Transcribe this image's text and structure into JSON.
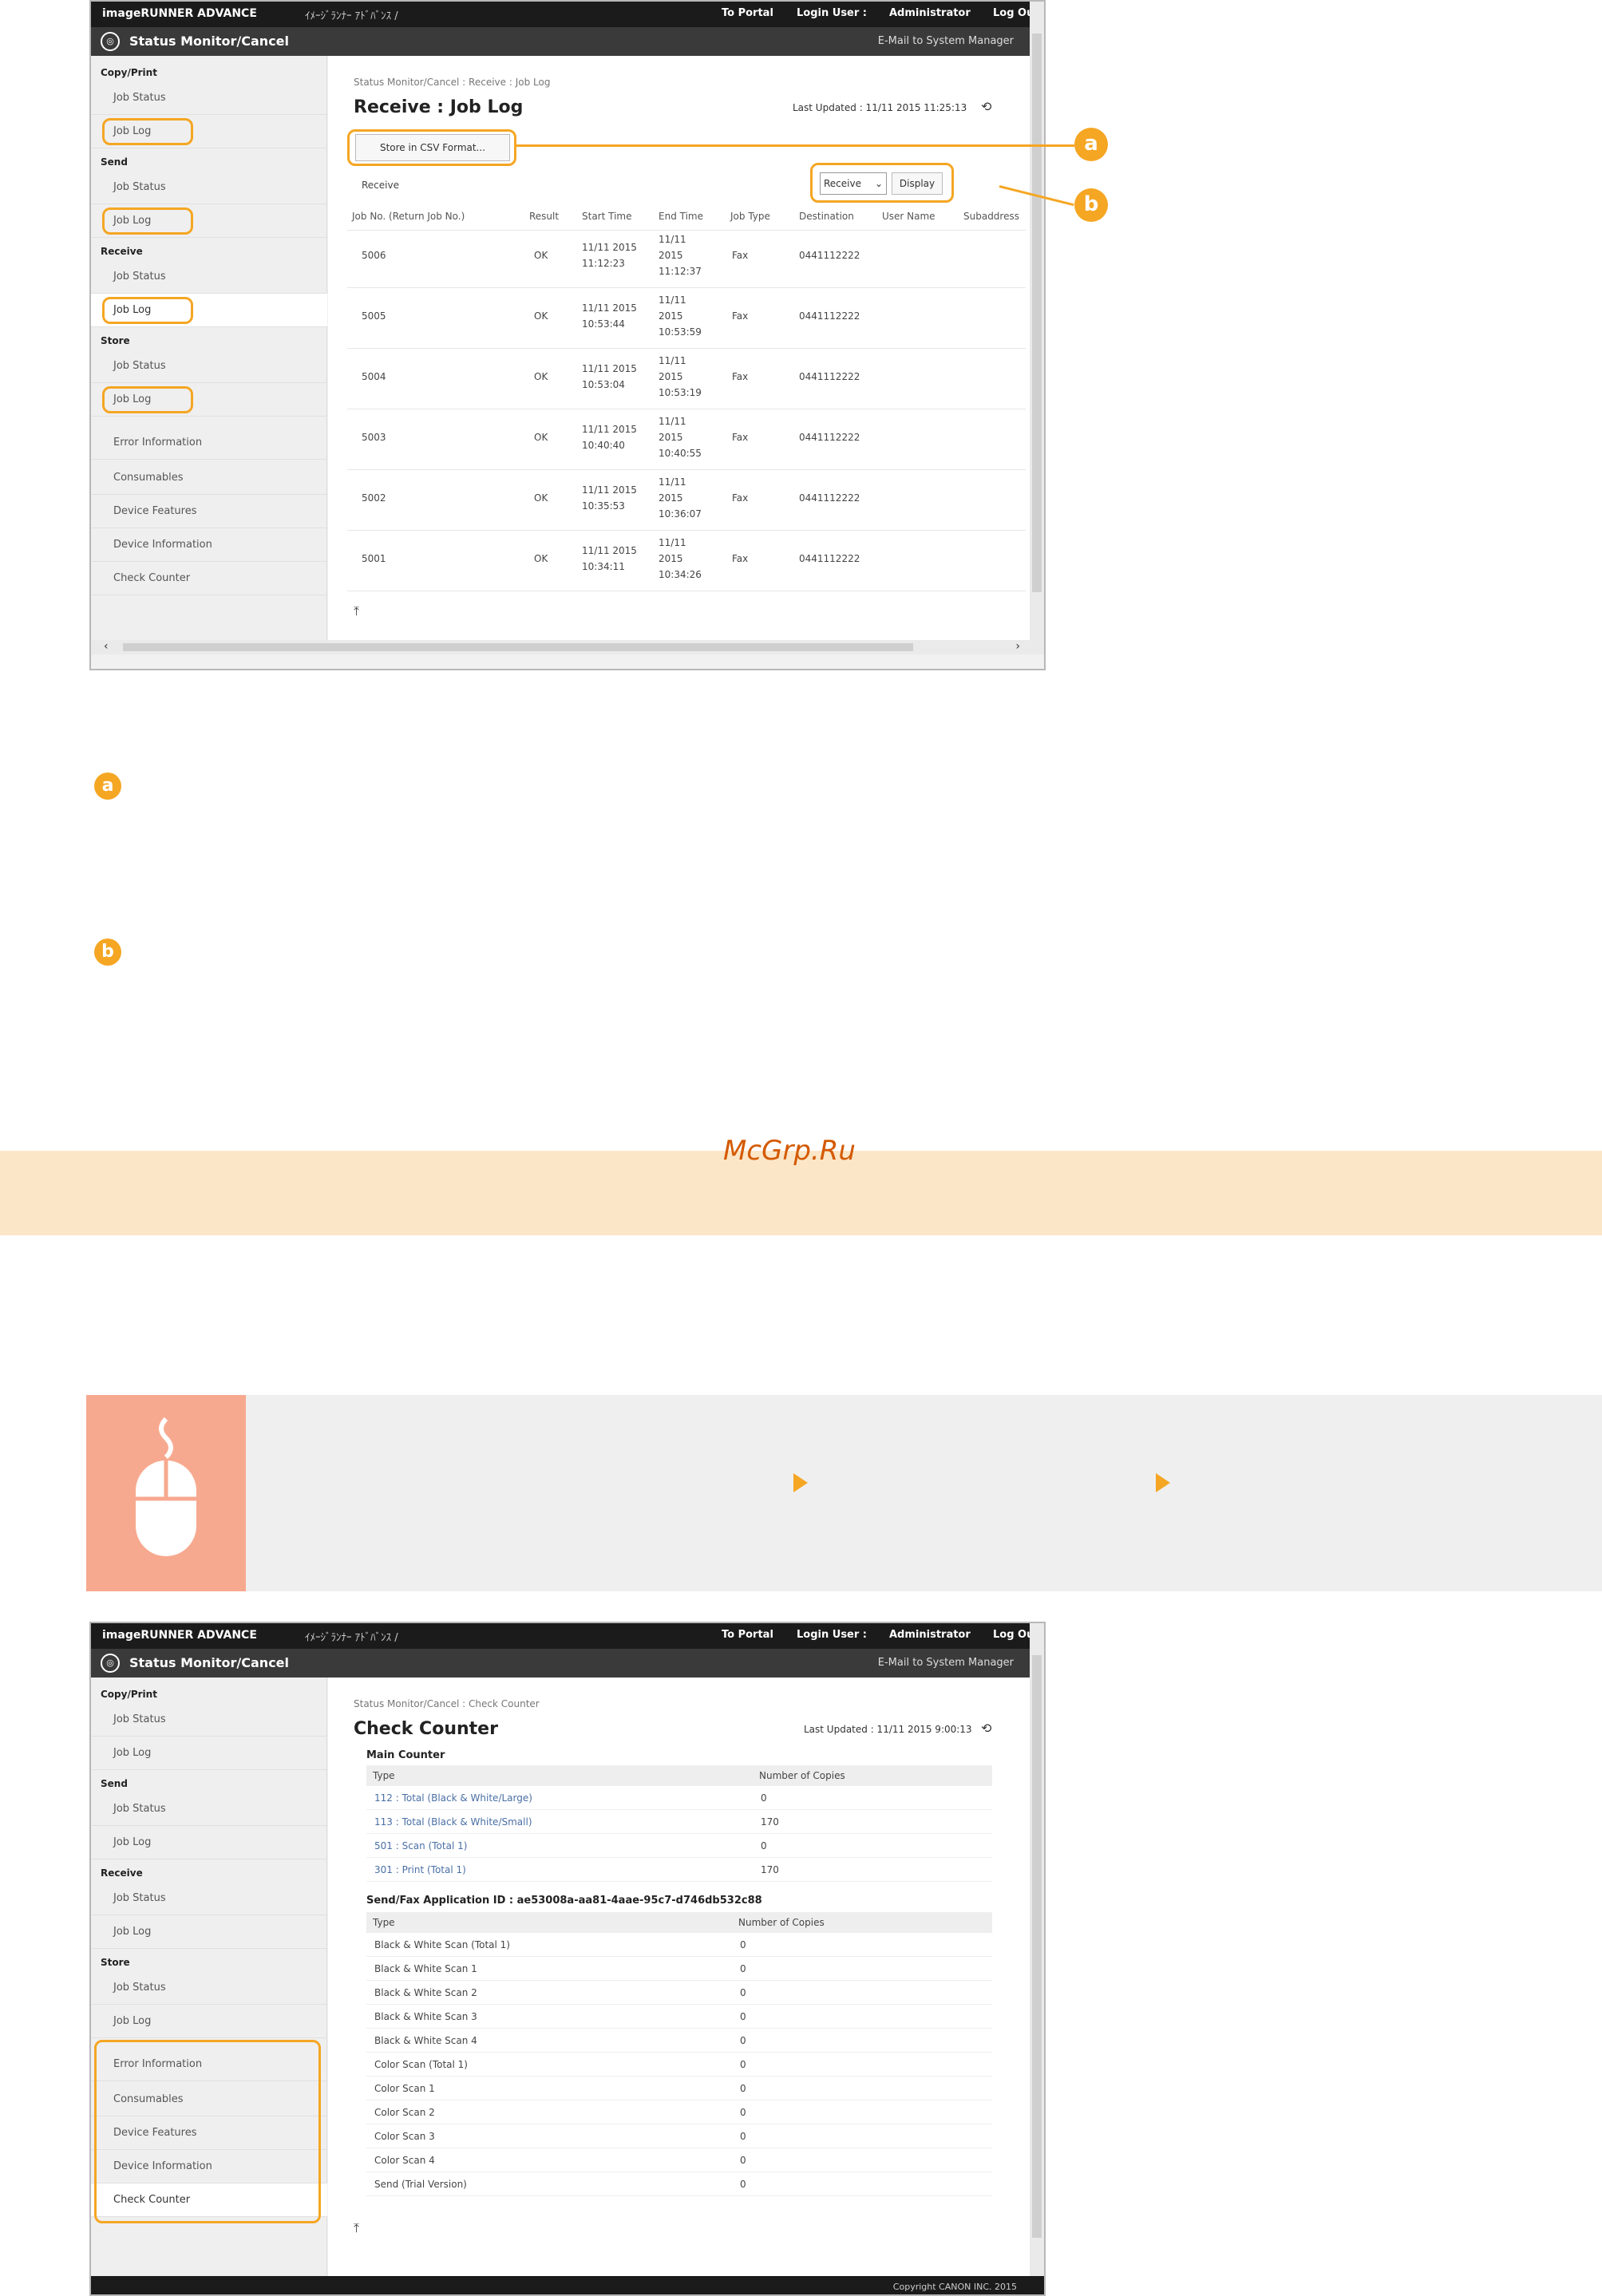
{
  "window": {
    "brand": "imageRUNNER ADVANCE",
    "ja_text": "ｲﾒｰｼﾞﾗﾝﾅｰ ｱﾄﾞﾊﾞﾝｽ /",
    "to_portal": "To Portal",
    "login_user": "Login User :",
    "admin": "Administrator",
    "logout": "Log Out",
    "app_name": "Status Monitor/Cancel",
    "mail": "E-Mail to System Manager"
  },
  "sidebar": {
    "copy_print": "Copy/Print",
    "send": "Send",
    "receive": "Receive",
    "store": "Store",
    "job_status": "Job Status",
    "job_log": "Job Log",
    "error_info": "Error Information",
    "consumables": "Consumables",
    "device_features": "Device Features",
    "device_info": "Device Information",
    "check_counter": "Check Counter"
  },
  "joblog": {
    "breadcrumb": "Status Monitor/Cancel : Receive : Job Log",
    "title": "Receive : Job Log",
    "updated": "Last Updated : 11/11 2015 11:25:13",
    "store_csv": "Store in CSV Format...",
    "section": "Receive",
    "select_value": "Receive",
    "display": "Display",
    "headers": [
      "Job No. (Return Job No.)",
      "Result",
      "Start Time",
      "End Time",
      "Job Type",
      "Destination",
      "User Name",
      "Subaddress"
    ],
    "rows": [
      [
        "5006",
        "OK",
        "11/11 2015 11:12:23",
        "11/11 2015 11:12:37",
        "Fax",
        "0441112222"
      ],
      [
        "5005",
        "OK",
        "11/11 2015 10:53:44",
        "11/11 2015 10:53:59",
        "Fax",
        "0441112222"
      ],
      [
        "5004",
        "OK",
        "11/11 2015 10:53:04",
        "11/11 2015 10:53:19",
        "Fax",
        "0441112222"
      ],
      [
        "5003",
        "OK",
        "11/11 2015 10:40:40",
        "11/11 2015 10:40:55",
        "Fax",
        "0441112222"
      ],
      [
        "5002",
        "OK",
        "11/11 2015 10:35:53",
        "11/11 2015 10:36:07",
        "Fax",
        "0441112222"
      ],
      [
        "5001",
        "OK",
        "11/11 2015 10:34:11",
        "11/11 2015 10:34:26",
        "Fax",
        "0441112222"
      ]
    ]
  },
  "callouts": {
    "a": "a",
    "b": "b"
  },
  "watermark": "McGrp.Ru",
  "counter": {
    "breadcrumb": "Status Monitor/Cancel : Check Counter",
    "title": "Check Counter",
    "updated": "Last Updated : 11/11 2015 9:00:13",
    "main_counter": "Main Counter",
    "type": "Type",
    "copies": "Number of Copies",
    "main_rows": [
      [
        "112 : Total (Black & White/Large)",
        "0"
      ],
      [
        "113 : Total (Black & White/Small)",
        "170"
      ],
      [
        "501 : Scan (Total 1)",
        "0"
      ],
      [
        "301 : Print (Total 1)",
        "170"
      ]
    ],
    "app_title": "Send/Fax Application ID : ae53008a-aa81-4aae-95c7-d746db532c88",
    "app_rows": [
      [
        "Black & White Scan (Total 1)",
        "0"
      ],
      [
        "Black & White Scan 1",
        "0"
      ],
      [
        "Black & White Scan 2",
        "0"
      ],
      [
        "Black & White Scan 3",
        "0"
      ],
      [
        "Black & White Scan 4",
        "0"
      ],
      [
        "Color Scan (Total 1)",
        "0"
      ],
      [
        "Color Scan 1",
        "0"
      ],
      [
        "Color Scan 2",
        "0"
      ],
      [
        "Color Scan 3",
        "0"
      ],
      [
        "Color Scan 4",
        "0"
      ],
      [
        "Send (Trial Version)",
        "0"
      ]
    ],
    "copyright": "Copyright CANON INC. 2015"
  }
}
